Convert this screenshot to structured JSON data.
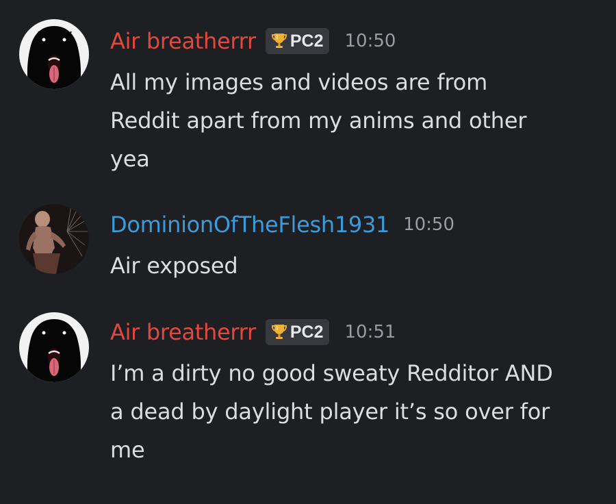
{
  "messages": [
    {
      "author": "Air breatherrr",
      "author_color": "#e2483d",
      "tag": "PC2",
      "tag_icon": "trophy-icon",
      "time": "10:50",
      "lines": [
        "All my images and videos are from",
        "Reddit apart from my anims and other",
        "yea"
      ]
    },
    {
      "author": "DominionOfTheFlesh1931",
      "author_color": "#3b9bdc",
      "time": "10:50",
      "lines": [
        "Air exposed"
      ]
    },
    {
      "author": "Air breatherrr",
      "author_color": "#e2483d",
      "tag": "PC2",
      "tag_icon": "trophy-icon",
      "time": "10:51",
      "lines": [
        "I’m a dirty no good sweaty Redditor AND",
        "a dead by daylight player it’s so over for",
        "me"
      ]
    }
  ]
}
